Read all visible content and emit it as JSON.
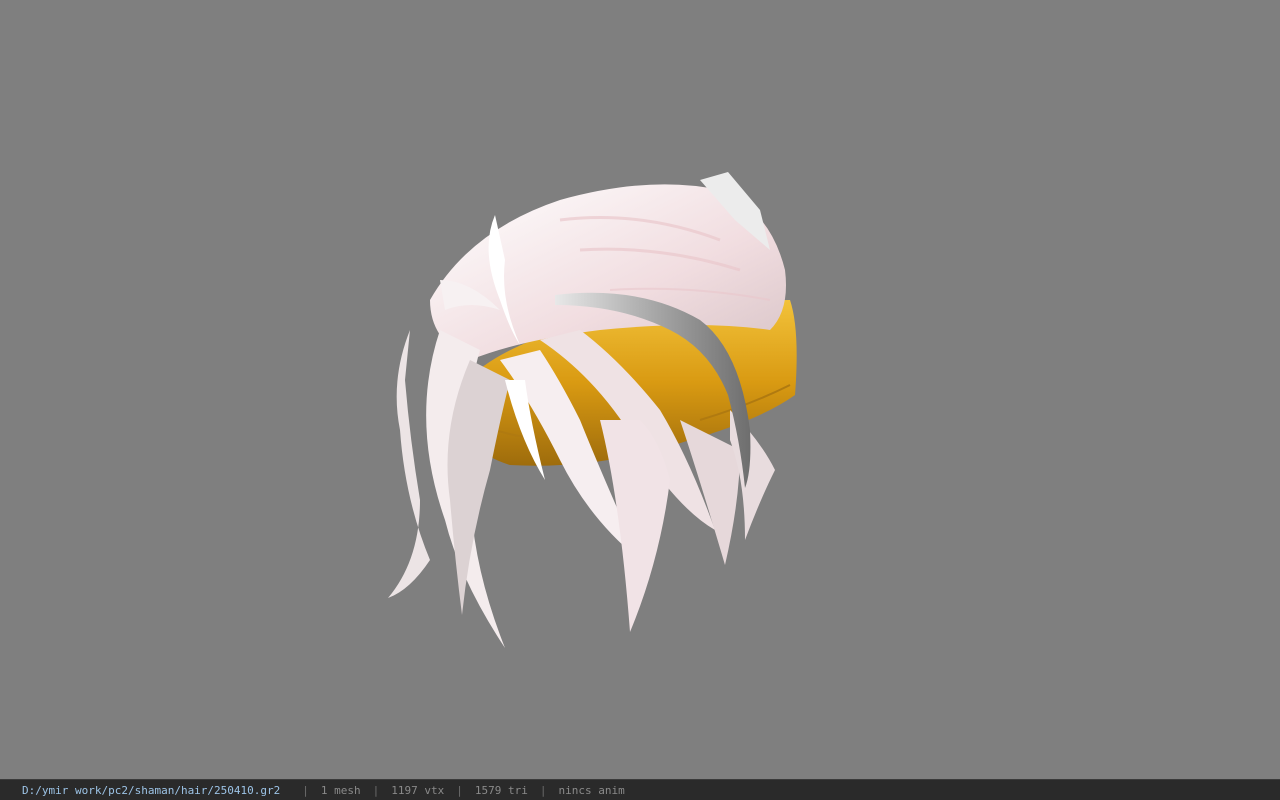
{
  "viewport": {
    "background_color": "#7f7f7f",
    "model": "stylized white hair with gold band and silver hairpin"
  },
  "statusbar": {
    "file_path": "D:/ymir work/pc2/shaman/hair/250410.gr2",
    "separator": "|",
    "mesh_count": "1 mesh",
    "vertex_count": "1197 vtx",
    "triangle_count": "1579 tri",
    "anim_status": "nincs anim"
  },
  "colors": {
    "hair": "#f3e6e8",
    "hair_shadow": "#c9b7ba",
    "band": "#e0a719",
    "band_shadow": "#a87510",
    "pin": "#b9b9b9"
  }
}
